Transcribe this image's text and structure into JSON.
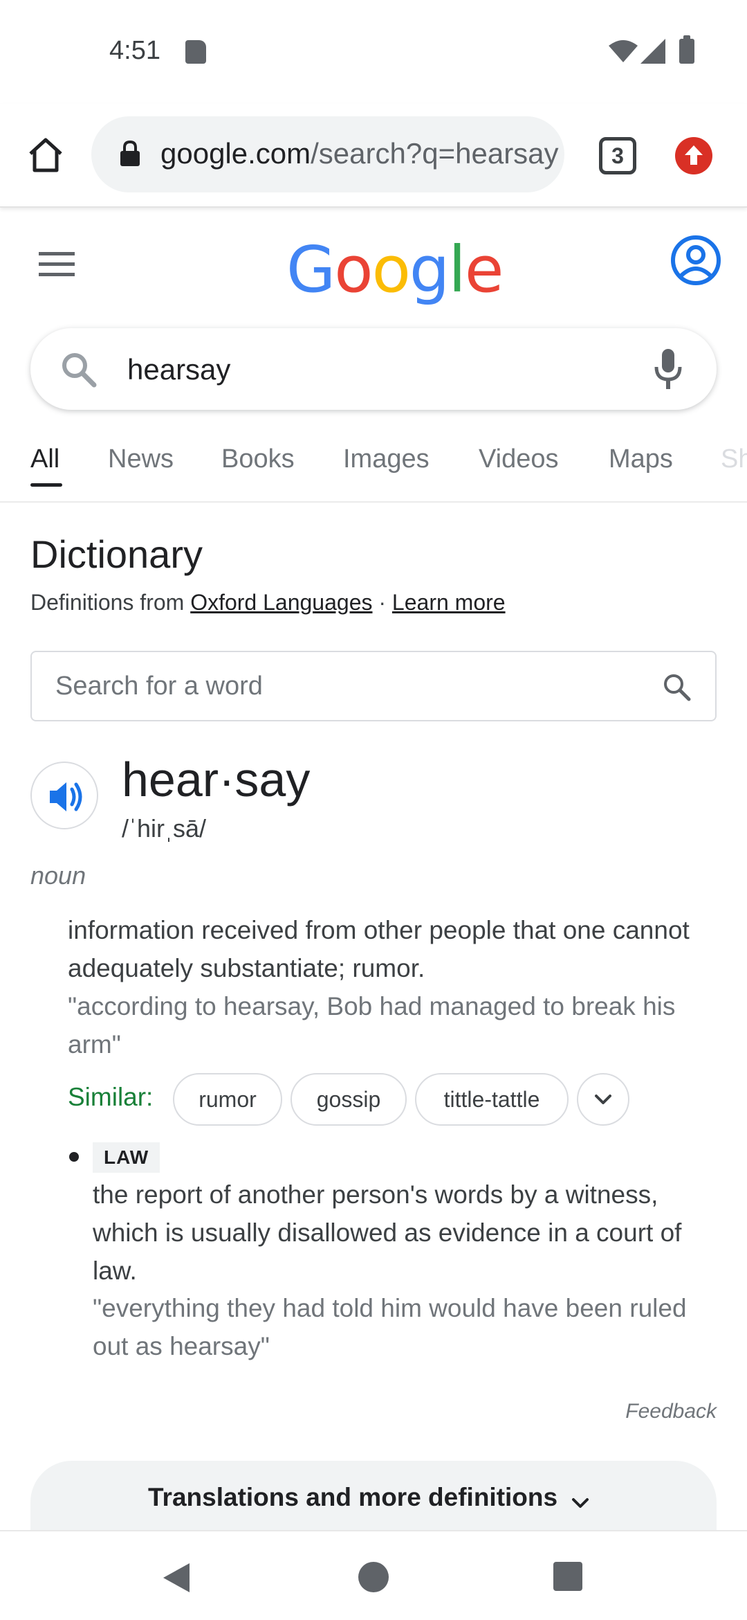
{
  "status_bar": {
    "time": "4:51"
  },
  "browser": {
    "url_domain": "google.com",
    "url_path": "/search?q=hearsay",
    "tab_count": "3"
  },
  "logo": {
    "letters": [
      "G",
      "o",
      "o",
      "g",
      "l",
      "e"
    ],
    "colors": [
      "#4285F4",
      "#EA4335",
      "#FBBC05",
      "#4285F4",
      "#34A853",
      "#EA4335"
    ]
  },
  "search": {
    "query": "hearsay"
  },
  "tabs": [
    {
      "label": "All",
      "active": true
    },
    {
      "label": "News"
    },
    {
      "label": "Books"
    },
    {
      "label": "Images"
    },
    {
      "label": "Videos"
    },
    {
      "label": "Maps"
    },
    {
      "label": "Sh"
    }
  ],
  "dictionary": {
    "title": "Dictionary",
    "source_prefix": "Definitions from ",
    "source_link": "Oxford Languages",
    "separator": " · ",
    "learn_more": "Learn more",
    "word_search_placeholder": "Search for a word",
    "headword": "hear·say",
    "phonetic": "/ˈhirˌsā/",
    "part_of_speech": "noun",
    "sense1": {
      "definition": "information received from other people that one cannot adequately substantiate; rumor.",
      "example": "\"according to hearsay, Bob had managed to break his arm\""
    },
    "similar_label": "Similar:",
    "similar": [
      "rumor",
      "gossip",
      "tittle-tattle"
    ],
    "sense2": {
      "tag": "LAW",
      "definition": "the report of another person's words by a witness, which is usually disallowed as evidence in a court of law.",
      "example": "\"everything they had told him would have been ruled out as hearsay\""
    },
    "feedback": "Feedback",
    "more_definitions": "Translations and more definitions"
  },
  "colors": {
    "accent_blue": "#1a73e8",
    "similar_green": "#188038",
    "update_red": "#d93025"
  }
}
